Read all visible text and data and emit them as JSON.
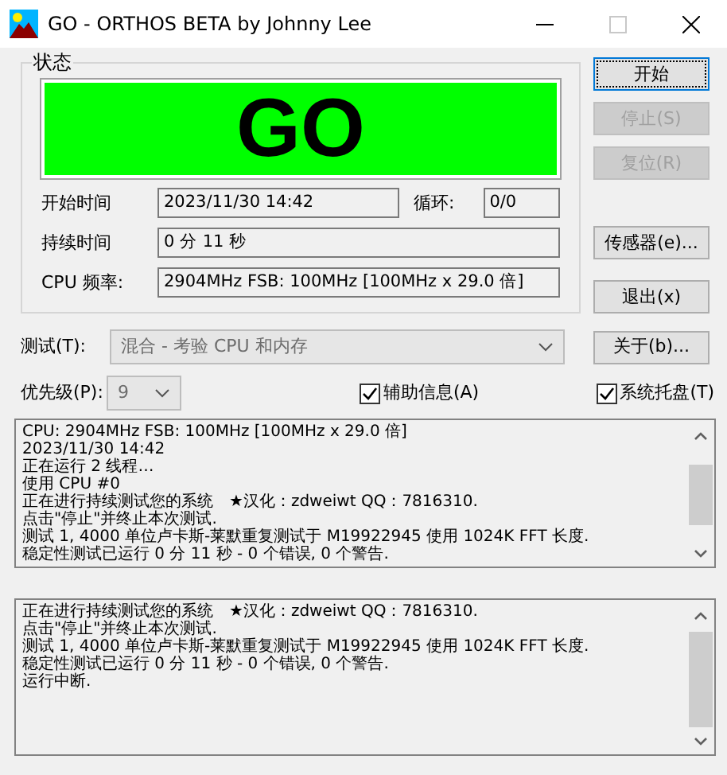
{
  "window": {
    "title": "GO - ORTHOS BETA by Johnny Lee"
  },
  "status_group": {
    "label": "状态",
    "banner": "GO",
    "fields": [
      {
        "label": "开始时间",
        "value": "2023/11/30 14:42",
        "extra_label": "循环:",
        "extra_value": "0/0"
      },
      {
        "label": "持续时间",
        "value": "0 分 11 秒"
      },
      {
        "label": "CPU 频率:",
        "value": "2904MHz FSB: 100MHz [100MHz x 29.0 倍]"
      }
    ]
  },
  "side_buttons": [
    {
      "label": "开始",
      "disabled": false,
      "default": true
    },
    {
      "label": "停止(S)",
      "disabled": true,
      "default": false
    },
    {
      "label": "复位(R)",
      "disabled": true,
      "default": false
    },
    {
      "label": "传感器(e)...",
      "disabled": false,
      "default": false
    },
    {
      "label": "退出(x)",
      "disabled": false,
      "default": false
    }
  ],
  "test": {
    "label": "测试(T):",
    "value": "混合 - 考验 CPU 和内存",
    "disabled": true
  },
  "about_button": {
    "label": "关于(b)..."
  },
  "priority": {
    "label": "优先级(P):",
    "value": "9",
    "disabled": true
  },
  "checkboxes": [
    {
      "label": "辅助信息(A)",
      "checked": true
    },
    {
      "label": "系统托盘(T)",
      "checked": true
    }
  ],
  "logs": [
    {
      "lines": [
        "CPU: 2904MHz FSB: 100MHz [100MHz x 29.0 倍]",
        "2023/11/30 14:42",
        "正在运行 2 线程…",
        "使用 CPU #0",
        "正在进行持续测试您的系统　★汉化：zdweiwt QQ：7816310.",
        "点击\"停止\"并终止本次测试.",
        "测试 1, 4000 单位卢卡斯-莱默重复测试于 M19922945 使用 1024K FFT 长度.",
        "稳定性测试已运行 0 分 11 秒 - 0 个错误, 0 个警告."
      ]
    },
    {
      "lines": [
        "正在进行持续测试您的系统　★汉化：zdweiwt QQ：7816310.",
        "点击\"停止\"并终止本次测试.",
        "测试 1, 4000 单位卢卡斯-莱默重复测试于 M19922945 使用 1024K FFT 长度.",
        "稳定性测试已运行 0 分 11 秒 - 0 个错误, 0 个警告.",
        "运行中断."
      ]
    }
  ]
}
